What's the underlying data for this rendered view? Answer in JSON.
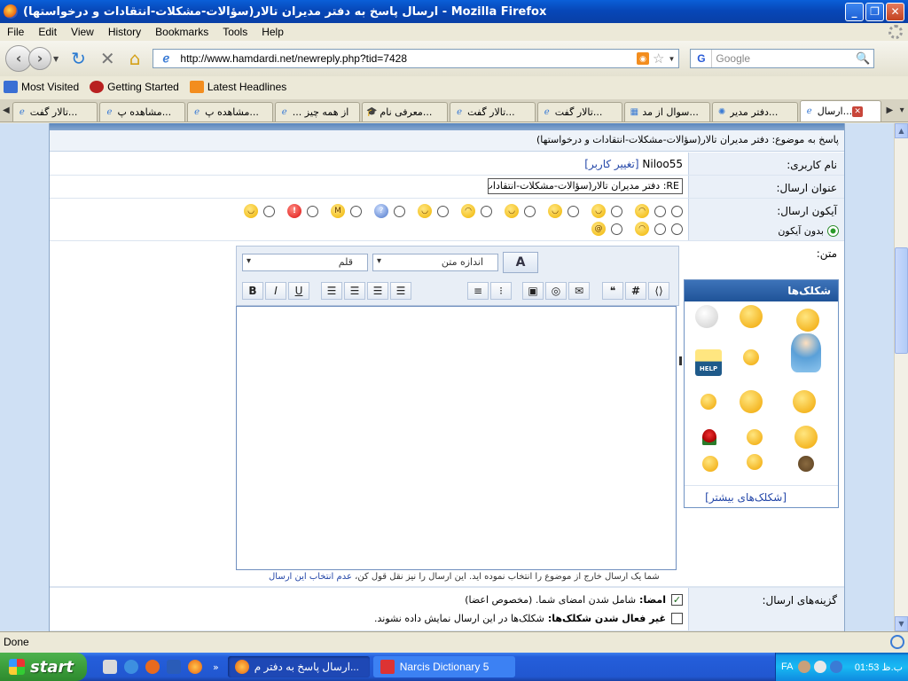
{
  "window": {
    "title": "ارسال پاسخ به دفتر مدیران تالار(سؤالات-مشکلات-انتقادات و درخواستها) - Mozilla Firefox",
    "minimize": "_",
    "maximize": "❐",
    "close": "✕"
  },
  "menu": [
    "File",
    "Edit",
    "View",
    "History",
    "Bookmarks",
    "Tools",
    "Help"
  ],
  "nav": {
    "url": "http://www.hamdardi.net/newreply.php?tid=7428",
    "search_placeholder": "Google",
    "search_engine": "G"
  },
  "bookmarks": [
    "Most Visited",
    "Getting Started",
    "Latest Headlines"
  ],
  "tabs": [
    {
      "label": "تالار گفت..."
    },
    {
      "label": "مشاهده پ..."
    },
    {
      "label": "مشاهده پ..."
    },
    {
      "label": "... از همه چیز"
    },
    {
      "label": "معرفی نام..."
    },
    {
      "label": "تالار گفت..."
    },
    {
      "label": "تالار گفت..."
    },
    {
      "label": "سوال از مد..."
    },
    {
      "label": "دفتر مدیر..."
    },
    {
      "label": "ارسال...",
      "active": true
    }
  ],
  "page": {
    "subject_line": "پاسخ به موضوع: دفتر مدیران تالار(سؤالات-مشکلات-انتقادات و درخواستها)",
    "username_label": "نام کاربری:",
    "username": "Niloo55",
    "change_user": "[تغییر کاربر]",
    "post_title_label": "عنوان ارسال:",
    "post_title_value": "RE: دفتر مدیران تالار(سؤالات-مشکلات-انتقادات",
    "post_icon_label": "آیکون ارسال:",
    "no_icon_label": "بدون آیکون",
    "message_label": "متن:",
    "editor": {
      "font_select": "قلم",
      "size_select": "اندازه متن",
      "color_button": "A",
      "bold": "B",
      "italic": "I",
      "underline": "U",
      "hash": "#"
    },
    "smilies_title": "شکلک‌ها",
    "more_smilies": "[شکلک‌های بیشتر]",
    "quote_note": "شما یک ارسال خارج از موضوع را انتخاب نموده اید. این ارسال را نیز نقل قول کن",
    "quote_note_link": "عدم انتخاب این ارسال",
    "options_label": "گزینه‌های ارسال:",
    "option_signature_bold": "امضا:",
    "option_signature": "شامل شدن امضای شما. (مخصوص اعضا)",
    "option_signature_checked": "✓",
    "option_smilies_bold": "غیر فعال شدن شکلک‌ها:",
    "option_smilies": "شکلک‌ها در این ارسال نمایش داده نشوند."
  },
  "status": {
    "text": "Done"
  },
  "taskbar": {
    "start": "start",
    "tasks": [
      "ارسال پاسخ به دفتر م...",
      "Narcis Dictionary 5"
    ],
    "lang": "FA",
    "clock": "01:53 ب.ظ",
    "more": "»"
  }
}
